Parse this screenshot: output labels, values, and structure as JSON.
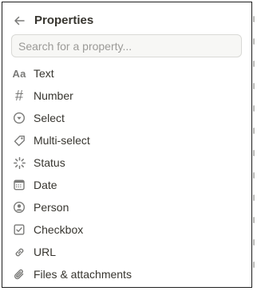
{
  "header": {
    "title": "Properties",
    "back_icon": "arrow-left-icon"
  },
  "search": {
    "placeholder": "Search for a property...",
    "value": ""
  },
  "properties": [
    {
      "label": "Text",
      "icon": "text-aa-icon"
    },
    {
      "label": "Number",
      "icon": "hash-icon"
    },
    {
      "label": "Select",
      "icon": "select-chevron-circle-icon"
    },
    {
      "label": "Multi-select",
      "icon": "tag-icon"
    },
    {
      "label": "Status",
      "icon": "status-spinner-icon"
    },
    {
      "label": "Date",
      "icon": "calendar-icon"
    },
    {
      "label": "Person",
      "icon": "person-circle-icon"
    },
    {
      "label": "Checkbox",
      "icon": "checkbox-icon"
    },
    {
      "label": "URL",
      "icon": "link-icon"
    },
    {
      "label": "Files & attachments",
      "icon": "paperclip-icon"
    }
  ],
  "colors": {
    "text": "#37352f",
    "icon": "#7a7a78",
    "placeholder": "#9b9a97",
    "search_bg": "#f7f7f5",
    "border": "#1f1f1f"
  }
}
